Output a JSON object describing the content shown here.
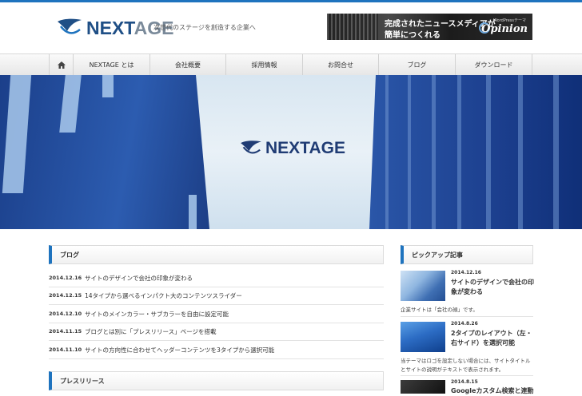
{
  "header": {
    "logo_a": "NEXT",
    "logo_b": "AGE",
    "tagline": "次世代のステージを創造する企業へ",
    "banner": {
      "line1": "完成されたニュースメディアが",
      "line2": "簡単につくれる",
      "brand_small": "WordPressテーマ",
      "brand": "Opinion"
    }
  },
  "nav": {
    "items": [
      "NEXTAGE とは",
      "会社概要",
      "採用情報",
      "お問合せ",
      "ブログ",
      "ダウンロード"
    ]
  },
  "hero": {
    "logo": "NEXTAGE"
  },
  "blog": {
    "heading": "ブログ",
    "posts": [
      {
        "date": "2014.12.16",
        "title": "サイトのデザインで会社の印象が変わる"
      },
      {
        "date": "2014.12.15",
        "title": "14タイプから選べるインパクト大のコンテンツスライダー"
      },
      {
        "date": "2014.12.10",
        "title": "サイトのメインカラー・サブカラーを自由に設定可能"
      },
      {
        "date": "2014.11.15",
        "title": "ブログとは別に「プレスリリース」ページを搭載"
      },
      {
        "date": "2014.11.10",
        "title": "サイトの方向性に合わせてヘッダーコンテンツを3タイプから選択可能"
      }
    ]
  },
  "press": {
    "heading": "プレスリリース"
  },
  "pickup": {
    "heading": "ピックアップ記事",
    "items": [
      {
        "date": "2014.12.16",
        "title": "サイトのデザインで会社の印象が変わる",
        "desc": "企業サイトは「会社の顔」です。"
      },
      {
        "date": "2014.8.26",
        "title": "2タイプのレイアウト（左・右サイド）を選択可能",
        "desc": "当テーマはロゴを設定しない場合には、サイトタイトルとサイトの説明がテキストで表示されます。"
      },
      {
        "date": "2014.8.15",
        "title": "Googleカスタム検索と連動",
        "desc": ""
      }
    ]
  },
  "colors": {
    "accent": "#1e73be",
    "logo_blue": "#1f4f86"
  }
}
